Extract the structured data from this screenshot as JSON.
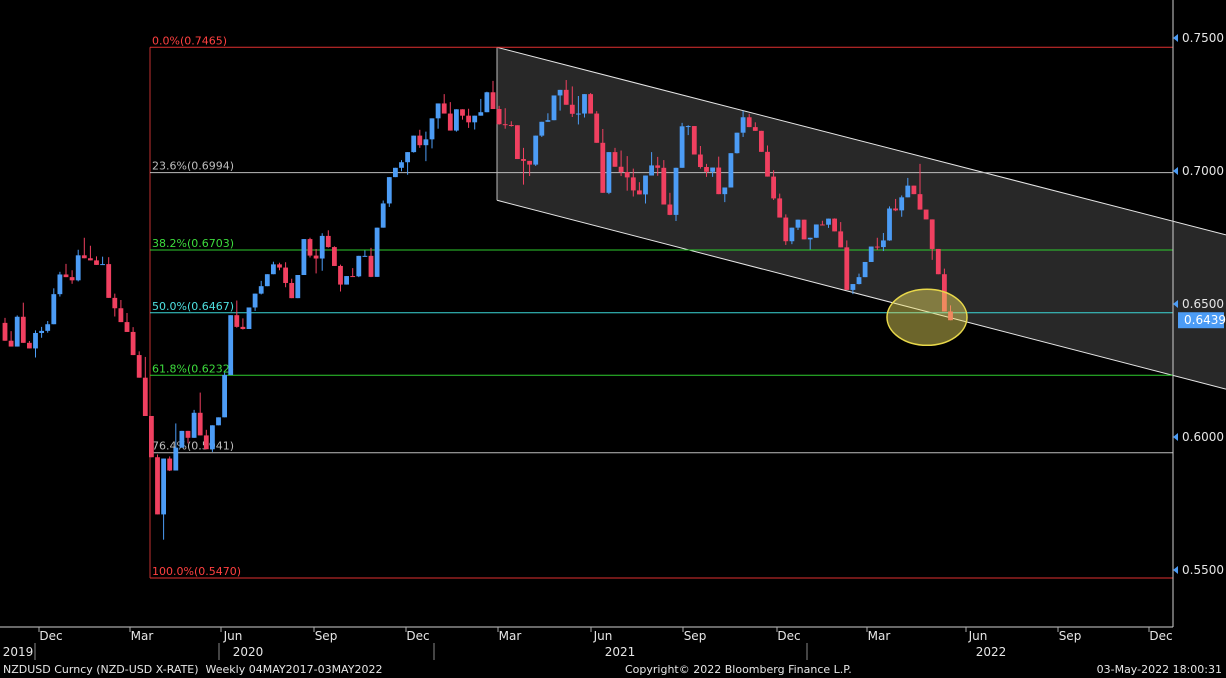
{
  "chart_data": {
    "type": "candlestick",
    "instrument": "NZDUSD Curncy (NZD-USD X-RATE)",
    "period_label": "Weekly 04MAY2017-03MAY2022",
    "copyright": "Copyright© 2022 Bloomberg Finance L.P.",
    "timestamp": "03-May-2022 18:00:31",
    "last_price": "0.6439",
    "ylim": [
      0.53,
      0.76
    ],
    "y_ticks": [
      "0.5500",
      "0.6000",
      "0.6500",
      "0.7000",
      "0.7500"
    ],
    "month_ticks": [
      "Dec",
      "Mar",
      "Jun",
      "Sep",
      "Dec",
      "Mar",
      "Jun",
      "Sep",
      "Dec",
      "Mar",
      "Jun",
      "Sep",
      "Dec"
    ],
    "year_ticks": [
      "2019",
      "2020",
      "2021",
      "2022"
    ],
    "fib_levels": [
      {
        "label": "0.0%(0.7465)",
        "value": 0.7465,
        "color": "#e03030",
        "text_color": "#ff4040"
      },
      {
        "label": "23.6%(0.6994)",
        "value": 0.6994,
        "color": "#bdbdbd",
        "text_color": "#bdbdbd"
      },
      {
        "label": "38.2%(0.6703)",
        "value": 0.6703,
        "color": "#2ecc2e",
        "text_color": "#3ddc3d"
      },
      {
        "label": "50.0%(0.6467)",
        "value": 0.6467,
        "color": "#3ad6d6",
        "text_color": "#4ee0e0"
      },
      {
        "label": "61.8%(0.6232)",
        "value": 0.6232,
        "color": "#2ecc2e",
        "text_color": "#3ddc3d"
      },
      {
        "label": "76.4%(0.5941)",
        "value": 0.5941,
        "color": "#bdbdbd",
        "text_color": "#bdbdbd"
      },
      {
        "label": "100.0%(0.5470)",
        "value": 0.547,
        "color": "#e03030",
        "text_color": "#ff4040"
      }
    ],
    "channel": {
      "upper": {
        "start_value": 0.7465,
        "end_value": 0.676
      },
      "lower": {
        "start_value": 0.689,
        "end_value": 0.618
      },
      "start": "Feb 2021",
      "end": "Apr 2023"
    },
    "highlight": {
      "value": 0.645,
      "note": "circled zone around 50% retracement"
    },
    "up_color": "#4c9cf5",
    "down_color": "#f04060",
    "ohlc": [
      [
        0.6429,
        0.6448,
        0.6375,
        0.6362
      ],
      [
        0.6362,
        0.6398,
        0.6351,
        0.634
      ],
      [
        0.634,
        0.6457,
        0.6345,
        0.6452
      ],
      [
        0.6452,
        0.6505,
        0.6357,
        0.6354
      ],
      [
        0.6354,
        0.6361,
        0.6361,
        0.6333
      ],
      [
        0.6333,
        0.6401,
        0.6299,
        0.6391
      ],
      [
        0.6391,
        0.6414,
        0.6373,
        0.6399
      ],
      [
        0.6399,
        0.6436,
        0.6392,
        0.6424
      ],
      [
        0.6424,
        0.6559,
        0.6459,
        0.6537
      ],
      [
        0.6537,
        0.6621,
        0.6528,
        0.6611
      ],
      [
        0.6611,
        0.6639,
        0.6651,
        0.6601
      ],
      [
        0.6601,
        0.6627,
        0.6576,
        0.6589
      ],
      [
        0.6589,
        0.6704,
        0.6585,
        0.6683
      ],
      [
        0.6683,
        0.6749,
        0.6674,
        0.6672
      ],
      [
        0.6672,
        0.6719,
        0.6672,
        0.6664
      ],
      [
        0.6664,
        0.6679,
        0.6659,
        0.6647
      ],
      [
        0.6647,
        0.6678,
        0.6651,
        0.665
      ],
      [
        0.665,
        0.6676,
        0.6527,
        0.6523
      ],
      [
        0.6523,
        0.6539,
        0.6453,
        0.6484
      ],
      [
        0.6484,
        0.6515,
        0.6453,
        0.6432
      ],
      [
        0.6432,
        0.6466,
        0.6438,
        0.6395
      ],
      [
        0.6395,
        0.6413,
        0.6309,
        0.6308
      ],
      [
        0.6308,
        0.6322,
        0.6238,
        0.6223
      ],
      [
        0.6223,
        0.6301,
        0.6196,
        0.6079
      ],
      [
        0.6079,
        0.6075,
        0.5925,
        0.5924
      ],
      [
        0.5924,
        0.5934,
        0.5787,
        0.5709
      ],
      [
        0.5709,
        0.5774,
        0.5614,
        0.5919
      ],
      [
        0.5919,
        0.5927,
        0.5872,
        0.5874
      ],
      [
        0.5874,
        0.6051,
        0.5883,
        0.596
      ],
      [
        0.596,
        0.5995,
        0.6008,
        0.6023
      ],
      [
        0.6023,
        0.6015,
        0.5976,
        0.5997
      ],
      [
        0.5997,
        0.6102,
        0.6028,
        0.6091
      ],
      [
        0.6091,
        0.6167,
        0.6034,
        0.6006
      ],
      [
        0.6006,
        0.6027,
        0.5968,
        0.5954
      ],
      [
        0.5954,
        0.6025,
        0.5944,
        0.6044
      ],
      [
        0.6044,
        0.6055,
        0.6047,
        0.6074
      ],
      [
        0.6074,
        0.6242,
        0.6085,
        0.6233
      ],
      [
        0.6233,
        0.6455,
        0.6272,
        0.6458
      ],
      [
        0.6458,
        0.6513,
        0.6411,
        0.6414
      ],
      [
        0.6414,
        0.6446,
        0.6404,
        0.6406
      ],
      [
        0.6406,
        0.6485,
        0.6407,
        0.6487
      ],
      [
        0.6487,
        0.6512,
        0.6474,
        0.6539
      ],
      [
        0.6539,
        0.6587,
        0.6536,
        0.6567
      ],
      [
        0.6567,
        0.6581,
        0.6605,
        0.6612
      ],
      [
        0.6612,
        0.6659,
        0.6622,
        0.6649
      ],
      [
        0.6649,
        0.6655,
        0.6627,
        0.6637
      ],
      [
        0.6637,
        0.6657,
        0.6563,
        0.6579
      ],
      [
        0.6579,
        0.6595,
        0.6542,
        0.6522
      ],
      [
        0.6522,
        0.6533,
        0.6537,
        0.6609
      ],
      [
        0.6609,
        0.6737,
        0.6611,
        0.6744
      ],
      [
        0.6744,
        0.6749,
        0.6675,
        0.6682
      ],
      [
        0.6682,
        0.6707,
        0.6615,
        0.6671
      ],
      [
        0.6671,
        0.6766,
        0.6625,
        0.6756
      ],
      [
        0.6756,
        0.6777,
        0.6712,
        0.6714
      ],
      [
        0.6714,
        0.6717,
        0.6649,
        0.6643
      ],
      [
        0.6643,
        0.6648,
        0.6547,
        0.6573
      ],
      [
        0.6573,
        0.6594,
        0.6603,
        0.6605
      ],
      [
        0.6605,
        0.6635,
        0.6609,
        0.6604
      ],
      [
        0.6604,
        0.6612,
        0.6601,
        0.6681
      ],
      [
        0.6681,
        0.6701,
        0.6678,
        0.6681
      ],
      [
        0.6681,
        0.6711,
        0.6601,
        0.6602
      ],
      [
        0.6602,
        0.6754,
        0.6604,
        0.6787
      ],
      [
        0.6787,
        0.6889,
        0.6818,
        0.6878
      ],
      [
        0.6878,
        0.6944,
        0.6865,
        0.6977
      ],
      [
        0.6977,
        0.7002,
        0.6991,
        0.7012
      ],
      [
        0.7012,
        0.7041,
        0.6999,
        0.7033
      ],
      [
        0.7033,
        0.7039,
        0.6986,
        0.7071
      ],
      [
        0.7071,
        0.7101,
        0.7069,
        0.7133
      ],
      [
        0.7133,
        0.7155,
        0.7087,
        0.7097
      ],
      [
        0.7097,
        0.7148,
        0.7037,
        0.7119
      ],
      [
        0.7119,
        0.7188,
        0.7085,
        0.7198
      ],
      [
        0.7198,
        0.7225,
        0.7159,
        0.7254
      ],
      [
        0.7254,
        0.7289,
        0.7235,
        0.7216
      ],
      [
        0.7216,
        0.7259,
        0.7171,
        0.7152
      ],
      [
        0.7152,
        0.7204,
        0.7148,
        0.7232
      ],
      [
        0.7232,
        0.7226,
        0.7193,
        0.7208
      ],
      [
        0.7208,
        0.7234,
        0.7162,
        0.7183
      ],
      [
        0.7183,
        0.7194,
        0.7156,
        0.7208
      ],
      [
        0.7208,
        0.7271,
        0.7219,
        0.7221
      ],
      [
        0.7221,
        0.7298,
        0.7228,
        0.7296
      ],
      [
        0.7296,
        0.7339,
        0.7297,
        0.7233
      ],
      [
        0.7233,
        0.7245,
        0.7174,
        0.7176
      ],
      [
        0.7176,
        0.7236,
        0.7159,
        0.7173
      ],
      [
        0.7173,
        0.7187,
        0.7167,
        0.7172
      ],
      [
        0.7172,
        0.7166,
        0.7066,
        0.7045
      ],
      [
        0.7045,
        0.7087,
        0.6949,
        0.7038
      ],
      [
        0.7038,
        0.7032,
        0.6981,
        0.7024
      ],
      [
        0.7024,
        0.7026,
        0.7019,
        0.7133
      ],
      [
        0.7133,
        0.7151,
        0.7128,
        0.7185
      ],
      [
        0.7185,
        0.7217,
        0.7201,
        0.7191
      ],
      [
        0.7191,
        0.7245,
        0.7193,
        0.7284
      ],
      [
        0.7284,
        0.7304,
        0.7227,
        0.7305
      ],
      [
        0.7305,
        0.7342,
        0.7267,
        0.7249
      ],
      [
        0.7249,
        0.7318,
        0.7203,
        0.7215
      ],
      [
        0.7215,
        0.7282,
        0.7175,
        0.7216
      ],
      [
        0.7216,
        0.7258,
        0.7201,
        0.7289
      ],
      [
        0.7289,
        0.7293,
        0.7246,
        0.7216
      ],
      [
        0.7216,
        0.7225,
        0.7126,
        0.7106
      ],
      [
        0.7106,
        0.7158,
        0.7027,
        0.6918
      ],
      [
        0.6918,
        0.6939,
        0.6913,
        0.7071
      ],
      [
        0.7071,
        0.7087,
        0.7082,
        0.7016
      ],
      [
        0.7016,
        0.7077,
        0.6981,
        0.6996
      ],
      [
        0.6996,
        0.7056,
        0.6926,
        0.6976
      ],
      [
        0.6976,
        0.7009,
        0.6904,
        0.6927
      ],
      [
        0.6927,
        0.6958,
        0.6931,
        0.6912
      ],
      [
        0.6912,
        0.6923,
        0.6878,
        0.6983
      ],
      [
        0.6983,
        0.7071,
        0.6994,
        0.7021
      ],
      [
        0.7021,
        0.7053,
        0.6982,
        0.7012
      ],
      [
        0.7012,
        0.7041,
        0.6925,
        0.6874
      ],
      [
        0.6874,
        0.6918,
        0.6834,
        0.6835
      ],
      [
        0.6835,
        0.6855,
        0.6812,
        0.7012
      ],
      [
        0.7012,
        0.7181,
        0.7047,
        0.7168
      ],
      [
        0.7168,
        0.7172,
        0.7135,
        0.7169
      ],
      [
        0.7169,
        0.7155,
        0.7079,
        0.7062
      ],
      [
        0.7062,
        0.7094,
        0.7009,
        0.7015
      ],
      [
        0.7015,
        0.7027,
        0.6978,
        0.6997
      ],
      [
        0.6997,
        0.6985,
        0.6978,
        0.7013
      ],
      [
        0.7013,
        0.7054,
        0.6926,
        0.6913
      ],
      [
        0.6913,
        0.6932,
        0.6883,
        0.6938
      ],
      [
        0.6938,
        0.7009,
        0.6952,
        0.7067
      ],
      [
        0.7067,
        0.7136,
        0.7066,
        0.7144
      ],
      [
        0.7144,
        0.7226,
        0.7128,
        0.7202
      ],
      [
        0.7202,
        0.7215,
        0.7179,
        0.7165
      ],
      [
        0.7165,
        0.7183,
        0.7162,
        0.7151
      ],
      [
        0.7151,
        0.7148,
        0.7083,
        0.7072
      ],
      [
        0.7072,
        0.7096,
        0.7005,
        0.6979
      ],
      [
        0.6979,
        0.7003,
        0.6891,
        0.6897
      ],
      [
        0.6897,
        0.6915,
        0.6827,
        0.6825
      ],
      [
        0.6825,
        0.6837,
        0.6722,
        0.6736
      ],
      [
        0.6736,
        0.6775,
        0.6725,
        0.6787
      ],
      [
        0.6787,
        0.6801,
        0.6778,
        0.6817
      ],
      [
        0.6817,
        0.6811,
        0.6775,
        0.6743
      ],
      [
        0.6743,
        0.6747,
        0.6705,
        0.6749
      ],
      [
        0.6749,
        0.6785,
        0.6776,
        0.6799
      ],
      [
        0.6799,
        0.6813,
        0.6803,
        0.6798
      ],
      [
        0.6798,
        0.6818,
        0.6786,
        0.6821
      ],
      [
        0.6821,
        0.6822,
        0.6789,
        0.6773
      ],
      [
        0.6773,
        0.6808,
        0.6764,
        0.6713
      ],
      [
        0.6713,
        0.6739,
        0.6602,
        0.6553
      ],
      [
        0.6553,
        0.6566,
        0.6537,
        0.6575
      ],
      [
        0.6575,
        0.6614,
        0.6574,
        0.6601
      ],
      [
        0.6601,
        0.6614,
        0.6608,
        0.6658
      ],
      [
        0.6658,
        0.6706,
        0.6661,
        0.6716
      ],
      [
        0.6716,
        0.6749,
        0.6703,
        0.6714
      ],
      [
        0.6714,
        0.6767,
        0.6699,
        0.6739
      ],
      [
        0.6739,
        0.6867,
        0.6738,
        0.6859
      ],
      [
        0.6859,
        0.6895,
        0.6849,
        0.6852
      ],
      [
        0.6852,
        0.6908,
        0.6828,
        0.6901
      ],
      [
        0.6901,
        0.6974,
        0.6913,
        0.6945
      ],
      [
        0.6945,
        0.6936,
        0.6913,
        0.6913
      ],
      [
        0.6913,
        0.7027,
        0.6924,
        0.6855
      ],
      [
        0.6855,
        0.6851,
        0.6828,
        0.6818
      ],
      [
        0.6818,
        0.6816,
        0.6666,
        0.6707
      ],
      [
        0.6707,
        0.6677,
        0.6613,
        0.6612
      ],
      [
        0.6612,
        0.6633,
        0.6472,
        0.6472
      ],
      [
        0.6472,
        0.6495,
        0.6448,
        0.6439
      ]
    ]
  }
}
